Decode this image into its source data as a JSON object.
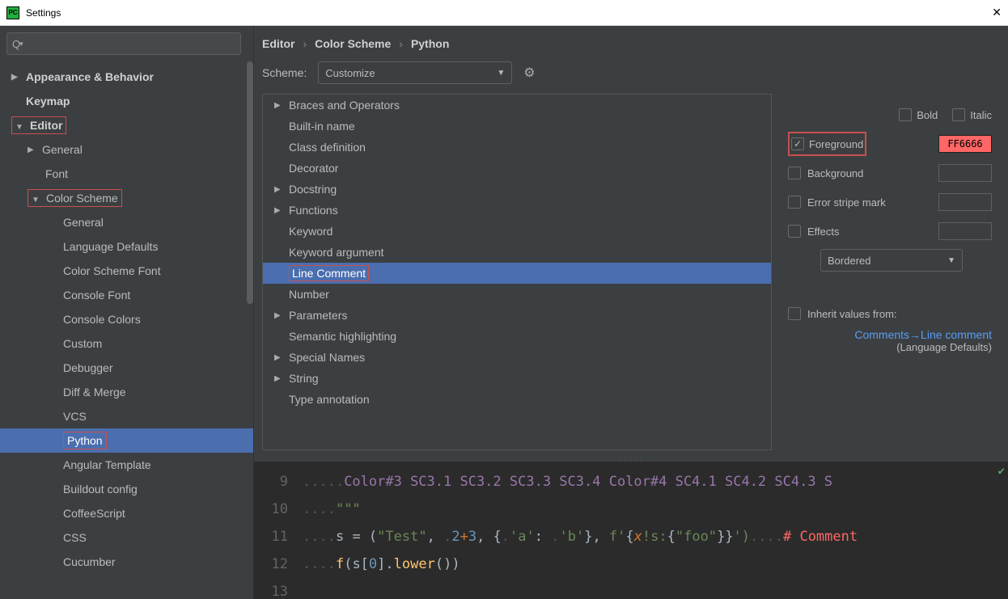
{
  "window": {
    "title": "Settings"
  },
  "breadcrumbs": [
    "Editor",
    "Color Scheme",
    "Python"
  ],
  "scheme": {
    "label": "Scheme:",
    "value": "Customize"
  },
  "sidebar": {
    "items": [
      {
        "label": "Appearance & Behavior",
        "level": 0,
        "expandable": true,
        "expanded": false,
        "bold": true
      },
      {
        "label": "Keymap",
        "level": 0,
        "bold": true,
        "indentNoArrow": true
      },
      {
        "label": "Editor",
        "level": 0,
        "expandable": true,
        "expanded": true,
        "bold": true,
        "highlight": true
      },
      {
        "label": "General",
        "level": 1,
        "expandable": true,
        "expanded": false
      },
      {
        "label": "Font",
        "level": 1,
        "indentNoArrow": true
      },
      {
        "label": "Color Scheme",
        "level": 1,
        "expandable": true,
        "expanded": true,
        "highlight": true
      },
      {
        "label": "General",
        "level": 2
      },
      {
        "label": "Language Defaults",
        "level": 2
      },
      {
        "label": "Color Scheme Font",
        "level": 2
      },
      {
        "label": "Console Font",
        "level": 2
      },
      {
        "label": "Console Colors",
        "level": 2
      },
      {
        "label": "Custom",
        "level": 2
      },
      {
        "label": "Debugger",
        "level": 2
      },
      {
        "label": "Diff & Merge",
        "level": 2
      },
      {
        "label": "VCS",
        "level": 2
      },
      {
        "label": "Python",
        "level": 2,
        "selected": true,
        "highlight": true
      },
      {
        "label": "Angular Template",
        "level": 2
      },
      {
        "label": "Buildout config",
        "level": 2
      },
      {
        "label": "CoffeeScript",
        "level": 2
      },
      {
        "label": "CSS",
        "level": 2
      },
      {
        "label": "Cucumber",
        "level": 2
      }
    ]
  },
  "attributes": [
    {
      "label": "Braces and Operators",
      "expandable": true
    },
    {
      "label": "Built-in name",
      "indent": true
    },
    {
      "label": "Class definition",
      "indent": true
    },
    {
      "label": "Decorator",
      "indent": true
    },
    {
      "label": "Docstring",
      "expandable": true
    },
    {
      "label": "Functions",
      "expandable": true
    },
    {
      "label": "Keyword",
      "indent": true
    },
    {
      "label": "Keyword argument",
      "indent": true
    },
    {
      "label": "Line Comment",
      "indent": true,
      "selected": true,
      "highlight": true
    },
    {
      "label": "Number",
      "indent": true
    },
    {
      "label": "Parameters",
      "expandable": true
    },
    {
      "label": "Semantic highlighting",
      "indent": true
    },
    {
      "label": "Special Names",
      "expandable": true
    },
    {
      "label": "String",
      "expandable": true
    },
    {
      "label": "Type annotation",
      "indent": true
    }
  ],
  "props": {
    "bold": "Bold",
    "italic": "Italic",
    "foreground": "Foreground",
    "foreground_value": "FF6666",
    "background": "Background",
    "error_stripe": "Error stripe mark",
    "effects": "Effects",
    "effects_value": "Bordered",
    "inherit_label": "Inherit values from:",
    "inherit_link": "Comments→Line comment",
    "inherit_sub": "(Language Defaults)"
  },
  "preview": {
    "lines": [
      {
        "n": "9",
        "rainbow": "Color#3 SC3.1 SC3.2 SC3.3 SC3.4 Color#4 SC4.1 SC4.2 SC4.3 S"
      },
      {
        "n": "10",
        "docstr": "\"\"\""
      },
      {
        "n": "11"
      },
      {
        "n": "12"
      },
      {
        "n": "13"
      }
    ],
    "l11": {
      "s": "s",
      "eq": " = (",
      "test": "\"Test\"",
      "c1": ", ",
      "n1": "2",
      "plus": "+",
      "n2": "3",
      "c2": ", {",
      "a": "'a'",
      "colon": ": ",
      "b": "'b'",
      "c3": "}, ",
      "fpre": "f'",
      "brace": "{",
      "x": "x",
      "excl": "!s:",
      "fooq": "{",
      "foo": "\"foo\"",
      "endb": "}}",
      "fend": "')",
      "dots": "    ",
      "cmt": "# Comment"
    },
    "l12": {
      "f": "f",
      "p1": "(s[",
      "z": "0",
      "p2": "].",
      "lower": "lower",
      "p3": "())"
    }
  }
}
